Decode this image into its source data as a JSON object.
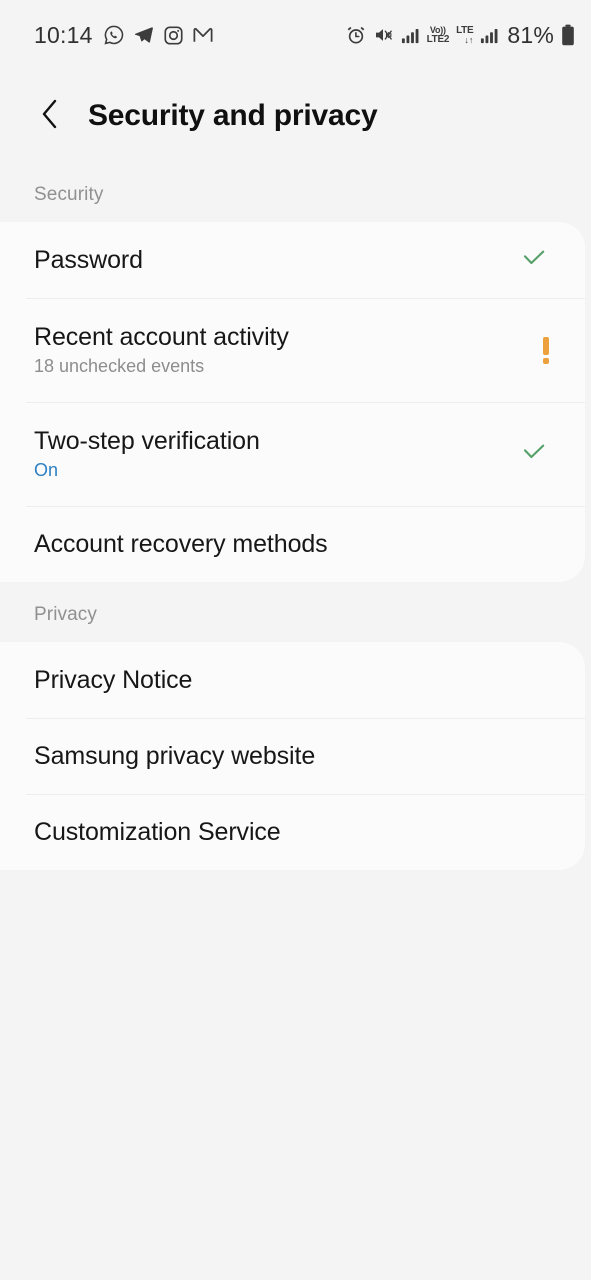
{
  "status_bar": {
    "time": "10:14",
    "battery_percent": "81%",
    "app_icons": [
      "whatsapp-icon",
      "telegram-icon",
      "instagram-icon",
      "gmail-icon"
    ],
    "system_icons": [
      "alarm-icon",
      "mute-vibrate-icon",
      "signal-bars-icon",
      "volte2-icon",
      "lte-data-icon",
      "signal-bars-2-icon",
      "battery-icon"
    ],
    "volte_label_top": "Vo))",
    "volte_label_bottom": "LTE2",
    "lte_label": "LTE",
    "lte_arrows": "↓↑"
  },
  "header": {
    "back_icon": "chevron-left-icon",
    "title": "Security and privacy"
  },
  "sections": [
    {
      "label": "Security",
      "items": [
        {
          "title": "Password",
          "subtitle": "",
          "status": "check"
        },
        {
          "title": "Recent account activity",
          "subtitle": "18 unchecked events",
          "status": "warning"
        },
        {
          "title": "Two-step verification",
          "subtitle": "On",
          "subtitle_style": "blue",
          "status": "check"
        },
        {
          "title": "Account recovery methods",
          "subtitle": "",
          "status": "none"
        }
      ]
    },
    {
      "label": "Privacy",
      "items": [
        {
          "title": "Privacy Notice",
          "subtitle": "",
          "status": "none"
        },
        {
          "title": "Samsung privacy website",
          "subtitle": "",
          "status": "none"
        },
        {
          "title": "Customization Service",
          "subtitle": "",
          "status": "none"
        }
      ]
    }
  ],
  "colors": {
    "page_background": "#f4f4f4",
    "card_background": "#fbfbfb",
    "check_green": "#55a068",
    "warning_orange": "#eda13c",
    "accent_blue": "#2e80c2",
    "title_text": "#101010",
    "secondary_text": "#8d8d8d"
  }
}
